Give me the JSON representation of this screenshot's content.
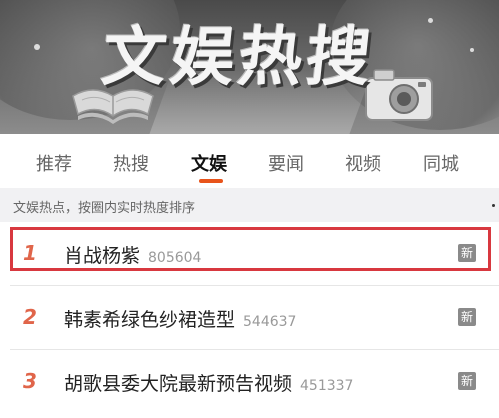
{
  "banner": {
    "title": "文娱热搜"
  },
  "tabs": [
    {
      "label": "推荐"
    },
    {
      "label": "热搜"
    },
    {
      "label": "文娱",
      "active": true
    },
    {
      "label": "要闻"
    },
    {
      "label": "视频"
    },
    {
      "label": "同城"
    }
  ],
  "subtitle": "文娱热点，按圈内实时热度排序",
  "list": [
    {
      "rank": "1",
      "title": "肖战杨紫",
      "count": "805604",
      "badge": "新"
    },
    {
      "rank": "2",
      "title": "韩素希绿色纱裙造型",
      "count": "544637",
      "badge": "新"
    },
    {
      "rank": "3",
      "title": "胡歌县委大院最新预告视频",
      "count": "451337",
      "badge": "新"
    }
  ],
  "colors": {
    "accent": "#e8541b",
    "rank": "#e0654a",
    "highlight_border": "#d8383f",
    "badge": "#8a8a8a"
  }
}
